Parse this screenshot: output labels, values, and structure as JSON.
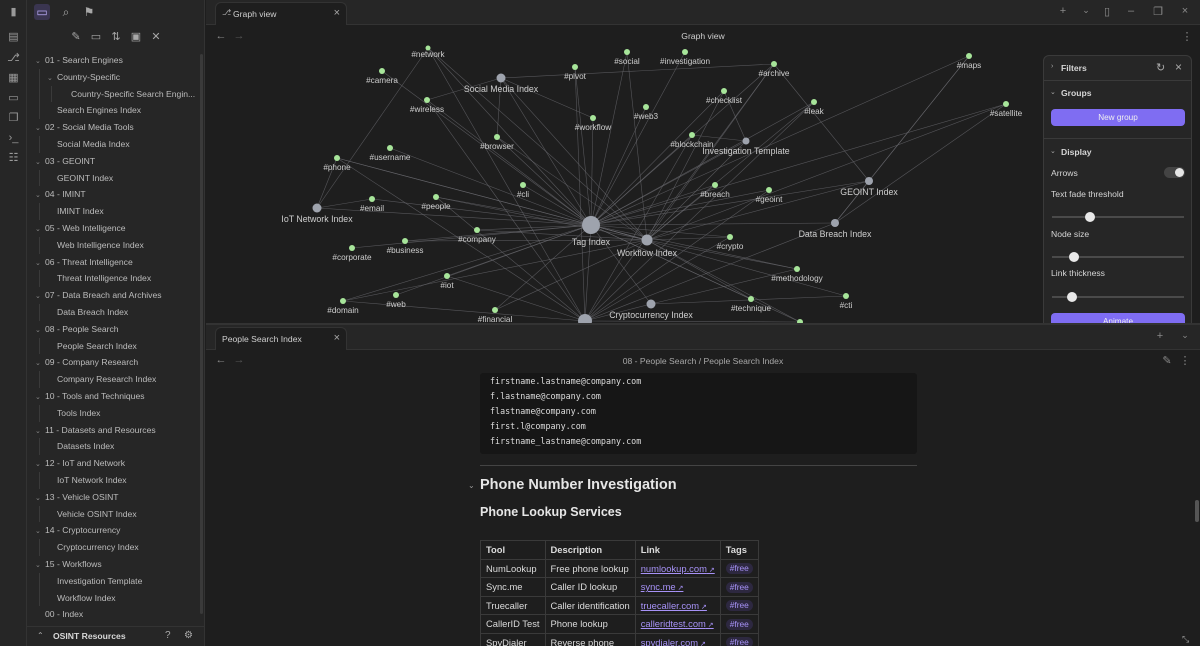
{
  "sidebar": {
    "tree": [
      {
        "label": "01 - Search Engines",
        "depth": 0,
        "folder": true
      },
      {
        "label": "Country-Specific",
        "depth": 1,
        "folder": true
      },
      {
        "label": "Country-Specific Search Engin...",
        "depth": 2,
        "folder": false
      },
      {
        "label": "Search Engines Index",
        "depth": 1,
        "folder": false
      },
      {
        "label": "02 - Social Media Tools",
        "depth": 0,
        "folder": true
      },
      {
        "label": "Social Media Index",
        "depth": 1,
        "folder": false
      },
      {
        "label": "03 - GEOINT",
        "depth": 0,
        "folder": true
      },
      {
        "label": "GEOINT Index",
        "depth": 1,
        "folder": false
      },
      {
        "label": "04 - IMINT",
        "depth": 0,
        "folder": true
      },
      {
        "label": "IMINT Index",
        "depth": 1,
        "folder": false
      },
      {
        "label": "05 - Web Intelligence",
        "depth": 0,
        "folder": true
      },
      {
        "label": "Web Intelligence Index",
        "depth": 1,
        "folder": false
      },
      {
        "label": "06 - Threat Intelligence",
        "depth": 0,
        "folder": true
      },
      {
        "label": "Threat Intelligence Index",
        "depth": 1,
        "folder": false
      },
      {
        "label": "07 - Data Breach and Archives",
        "depth": 0,
        "folder": true
      },
      {
        "label": "Data Breach Index",
        "depth": 1,
        "folder": false
      },
      {
        "label": "08 - People Search",
        "depth": 0,
        "folder": true
      },
      {
        "label": "People Search Index",
        "depth": 1,
        "folder": false
      },
      {
        "label": "09 - Company Research",
        "depth": 0,
        "folder": true
      },
      {
        "label": "Company Research Index",
        "depth": 1,
        "folder": false
      },
      {
        "label": "10 - Tools and Techniques",
        "depth": 0,
        "folder": true
      },
      {
        "label": "Tools Index",
        "depth": 1,
        "folder": false
      },
      {
        "label": "11 - Datasets and Resources",
        "depth": 0,
        "folder": true
      },
      {
        "label": "Datasets Index",
        "depth": 1,
        "folder": false
      },
      {
        "label": "12 - IoT and Network",
        "depth": 0,
        "folder": true
      },
      {
        "label": "IoT Network Index",
        "depth": 1,
        "folder": false
      },
      {
        "label": "13 - Vehicle OSINT",
        "depth": 0,
        "folder": true
      },
      {
        "label": "Vehicle OSINT Index",
        "depth": 1,
        "folder": false
      },
      {
        "label": "14 - Cryptocurrency",
        "depth": 0,
        "folder": true
      },
      {
        "label": "Cryptocurrency Index",
        "depth": 1,
        "folder": false
      },
      {
        "label": "15 - Workflows",
        "depth": 0,
        "folder": true
      },
      {
        "label": "Investigation Template",
        "depth": 1,
        "folder": false
      },
      {
        "label": "Workflow Index",
        "depth": 1,
        "folder": false
      },
      {
        "label": "00 - Index",
        "depth": 0,
        "folder": false
      }
    ],
    "vault_name": "OSINT Resources"
  },
  "graph_pane": {
    "tab_label": "Graph view",
    "title": "Graph view",
    "nodes": [
      {
        "label": "#network",
        "kind": "tag"
      },
      {
        "label": "#camera",
        "kind": "tag"
      },
      {
        "label": "Social Media Index",
        "kind": "note"
      },
      {
        "label": "#pivot",
        "kind": "tag"
      },
      {
        "label": "#social",
        "kind": "tag"
      },
      {
        "label": "#investigation",
        "kind": "tag"
      },
      {
        "label": "#archive",
        "kind": "tag"
      },
      {
        "label": "#maps",
        "kind": "tag"
      },
      {
        "label": "#satellite",
        "kind": "tag"
      },
      {
        "label": "#wireless",
        "kind": "tag"
      },
      {
        "label": "#checklist",
        "kind": "tag"
      },
      {
        "label": "#web3",
        "kind": "tag"
      },
      {
        "label": "#leak",
        "kind": "tag"
      },
      {
        "label": "#workflow",
        "kind": "tag"
      },
      {
        "label": "#browser",
        "kind": "tag"
      },
      {
        "label": "#blockchain",
        "kind": "tag"
      },
      {
        "label": "Investigation Template",
        "kind": "note"
      },
      {
        "label": "#username",
        "kind": "tag"
      },
      {
        "label": "#phone",
        "kind": "tag"
      },
      {
        "label": "#cli",
        "kind": "tag"
      },
      {
        "label": "#breach",
        "kind": "tag"
      },
      {
        "label": "#geoint",
        "kind": "tag"
      },
      {
        "label": "GEOINT Index",
        "kind": "note"
      },
      {
        "label": "#email",
        "kind": "tag"
      },
      {
        "label": "#people",
        "kind": "tag"
      },
      {
        "label": "IoT Network Index",
        "kind": "note"
      },
      {
        "label": "Tag Index",
        "kind": "hub"
      },
      {
        "label": "Data Breach Index",
        "kind": "note"
      },
      {
        "label": "#company",
        "kind": "tag"
      },
      {
        "label": "Workflow Index",
        "kind": "note"
      },
      {
        "label": "#crypto",
        "kind": "tag"
      },
      {
        "label": "#corporate",
        "kind": "tag"
      },
      {
        "label": "#business",
        "kind": "tag"
      },
      {
        "label": "#iot",
        "kind": "tag"
      },
      {
        "label": "#methodology",
        "kind": "tag"
      },
      {
        "label": "#web",
        "kind": "tag"
      },
      {
        "label": "#domain",
        "kind": "tag"
      },
      {
        "label": "#cti",
        "kind": "tag"
      },
      {
        "label": "#technique",
        "kind": "tag"
      },
      {
        "label": "Cryptocurrency Index",
        "kind": "note"
      },
      {
        "label": "#financial",
        "kind": "tag"
      },
      {
        "label": "",
        "kind": "note-big"
      },
      {
        "label": "",
        "kind": "tag"
      }
    ]
  },
  "filters": {
    "title": "Filters",
    "groups_label": "Groups",
    "new_group_button": "New group",
    "display_label": "Display",
    "arrows_label": "Arrows",
    "text_fade_label": "Text fade threshold",
    "node_size_label": "Node size",
    "link_thickness_label": "Link thickness",
    "animate_button": "Animate",
    "arrows_on": false,
    "text_fade_value": 0.27,
    "node_size_value": 0.14,
    "link_thickness_value": 0.12
  },
  "doc_pane": {
    "tab_label": "People Search Index",
    "breadcrumb_folder": "08 - People Search",
    "breadcrumb_sep": "/",
    "breadcrumb_note": "People Search Index",
    "code_lines": [
      "firstname.lastname@company.com",
      "f.lastname@company.com",
      "flastname@company.com",
      "first.l@company.com",
      "firstname_lastname@company.com"
    ],
    "heading2": "Phone Number Investigation",
    "heading3": "Phone Lookup Services",
    "table": {
      "headers": [
        "Tool",
        "Description",
        "Link",
        "Tags"
      ],
      "rows": [
        [
          "NumLookup",
          "Free phone lookup",
          "numlookup.com",
          "#free"
        ],
        [
          "Sync.me",
          "Caller ID lookup",
          "sync.me",
          "#free"
        ],
        [
          "Truecaller",
          "Caller identification",
          "truecaller.com",
          "#free"
        ],
        [
          "CallerID Test",
          "Phone lookup",
          "calleridtest.com",
          "#free"
        ],
        [
          "SpyDialer",
          "Reverse phone",
          "spydialer.com",
          "#free"
        ]
      ]
    }
  },
  "colors": {
    "accent": "#7f6df2",
    "tag_node": "#a7e59a",
    "note_node": "#9ea3ad",
    "background": "#1e1e1e",
    "panel": "#262626"
  }
}
